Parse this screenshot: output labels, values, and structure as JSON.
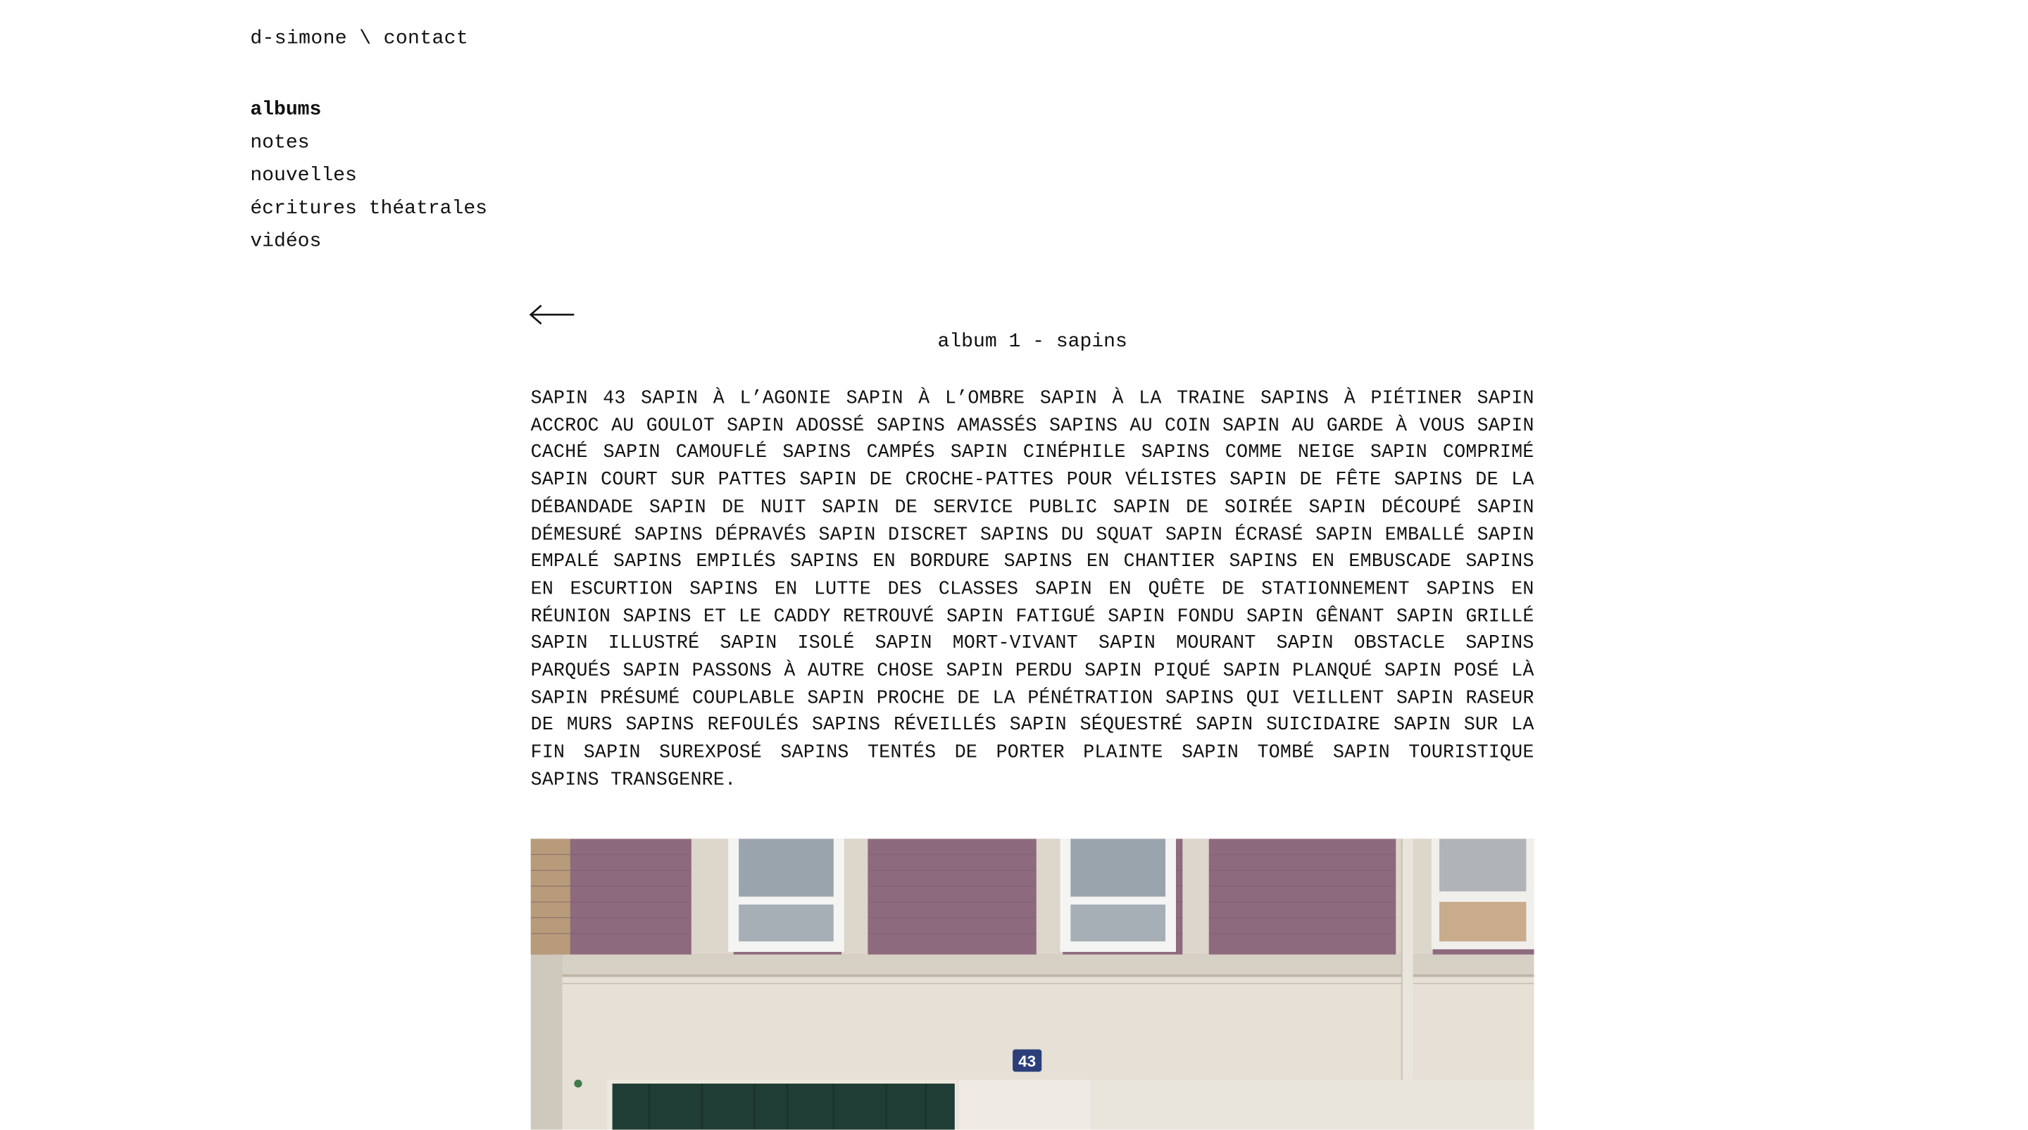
{
  "header": {
    "site_name": "d-simone",
    "separator": " \\ ",
    "contact_label": "contact"
  },
  "nav": {
    "items": [
      {
        "label": "albums",
        "active": true
      },
      {
        "label": "notes"
      },
      {
        "label": "nouvelles"
      },
      {
        "label": "écritures théatrales"
      },
      {
        "label": "vidéos"
      }
    ]
  },
  "back": {
    "icon": "arrow-left-icon"
  },
  "album": {
    "title": "album 1 - sapins",
    "text": "sapin 43 sapin à l’agonie sapin à l’ombre sapin à la traine sapins à piétiner sapin accroc au goulot sapin adossé sapins amassés sapins au coin sapin au garde à vous sapin caché sapin camouflé sapins campés sapin cinéphile sapins comme neige sapin comprimé sapin court sur pattes sapin de croche-pattes pour vélistes sapin de fête sapins de la débandade sapin de nuit sapin de service public sapin de soirée sapin découpé sapin démesuré sapins dépravés sapin discret sapins du squat sapin écrasé sapin emballé sapin empalé sapins empilés sapins en bordure sapins en chantier sapins en embuscade sapins en escurtion sapins en lutte des classes sapin en quête de stationnement sapins en réunion sapins et le caddy retrouvé sapin fatigué sapin fondu sapin gênant sapin grillé sapin illustré sapin isolé sapin mort-vivant sapin mourant sapin obstacle sapins parqués sapin passons à autre chose sapin perdu sapin piqué sapin planqué sapin posé là sapin présumé couplable sapin proche de la pénétration sapins qui veillent sapin raseur de murs sapins refoulés sapins réveillés sapin séquestré sapin suicidaire sapin sur la fin sapin surexposé sapins tentés de porter plainte sapin tombé sapin touristique sapins transgenre.",
    "photo": {
      "house_number": "43",
      "colors": {
        "wall": "#8e6a7e",
        "facade": "#e6e0d6",
        "door": "#1f3d35",
        "plate": "#2c3f7a"
      }
    }
  }
}
